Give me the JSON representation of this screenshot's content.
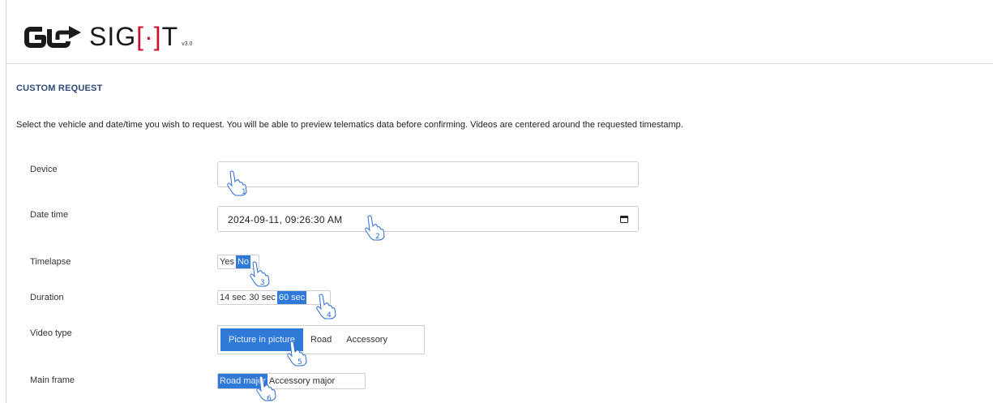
{
  "logo": {
    "sight_prefix": "SIG",
    "sight_suffix": "T",
    "version": "v3.0"
  },
  "page": {
    "section_title": "CUSTOM REQUEST",
    "description": "Select the vehicle and date/time you wish to request. You will be able to preview telematics data before confirming. Videos are centered around the requested timestamp."
  },
  "form": {
    "device": {
      "label": "Device",
      "value": ""
    },
    "datetime": {
      "label": "Date time",
      "value": "2024-09-11, 09:26:30 AM"
    },
    "timelapse": {
      "label": "Timelapse",
      "options": [
        "Yes",
        "No"
      ],
      "selected": "No"
    },
    "duration": {
      "label": "Duration",
      "options": [
        "14 sec",
        "30 sec",
        "60 sec"
      ],
      "selected": "60 sec"
    },
    "video_type": {
      "label": "Video type",
      "options": [
        "Picture in picture",
        "Road",
        "Accessory"
      ],
      "selected": "Picture in picture"
    },
    "main_frame": {
      "label": "Main frame",
      "options": [
        "Road major",
        "Accessory major"
      ],
      "selected": "Road major"
    }
  },
  "step_markers": [
    "1",
    "2",
    "3",
    "4",
    "5",
    "6"
  ],
  "colors": {
    "accent": "#2f7ad8",
    "title": "#2e4a76",
    "logo_red": "#d0102a"
  }
}
